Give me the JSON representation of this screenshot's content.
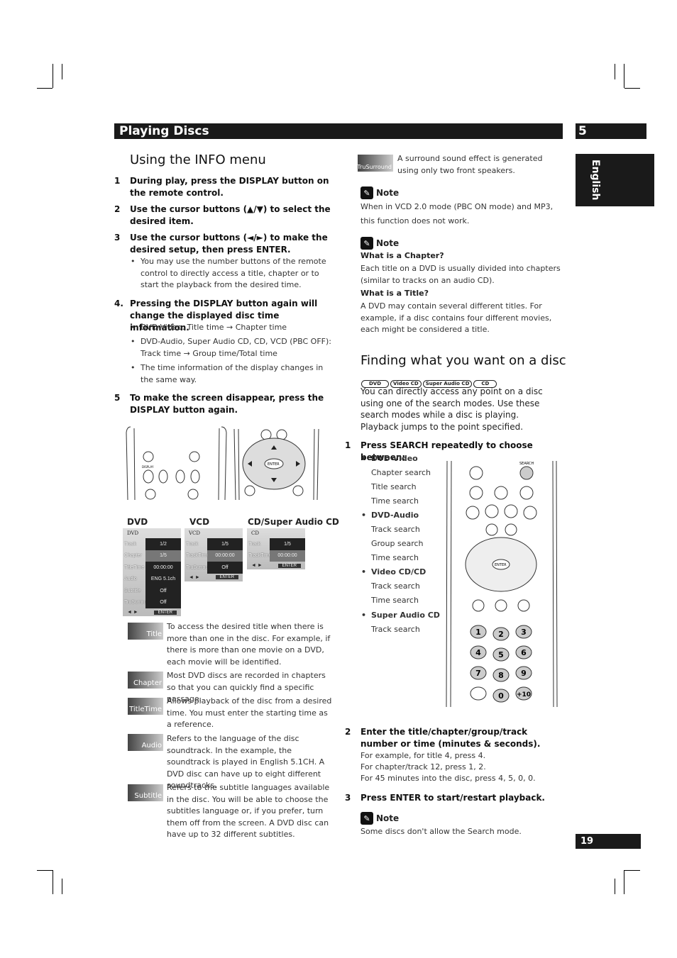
{
  "header": {
    "section_title": "Playing Discs",
    "chapter_number": "5",
    "side_tab": "English",
    "page_number": "19"
  },
  "left": {
    "title": "Using the INFO menu",
    "steps": [
      {
        "n": "1",
        "text": "During play, press the DISPLAY button on the remote control."
      },
      {
        "n": "2",
        "text": "Use the cursor buttons (▲/▼) to select the desired item."
      },
      {
        "n": "3",
        "text": "Use the cursor buttons (◄/►) to make the desired setup, then press ENTER."
      },
      {
        "n": "4.",
        "text": "Pressing the DISPLAY button again will change the displayed disc time information."
      },
      {
        "n": "5",
        "text": "To make the screen disappear, press the DISPLAY button again."
      }
    ],
    "step3_bullet": "You may use the number buttons of the remote control to directly access a title, chapter or to start the playback from the desired time.",
    "step4_bullets": [
      "DVD-Video: Title time → Chapter time",
      "DVD-Audio, Super Audio CD, CD, VCD (PBC OFF): Track time → Group time/Total time",
      "The time information of the display changes in the same way."
    ],
    "remote_labels": {
      "display": "DISPLAY",
      "enter": "ENTER"
    },
    "osd": {
      "dvd": {
        "caption": "DVD",
        "header": "DVD",
        "rows": [
          {
            "label": "Track",
            "value": "1/2"
          },
          {
            "label": "Chapter",
            "value": "1/5"
          },
          {
            "label": "TitleTime",
            "value": "00:00:00"
          },
          {
            "label": "Audio",
            "value": "ENG 5.1ch"
          },
          {
            "label": "Subtitle",
            "value": "Off"
          },
          {
            "label": "TruSurround",
            "value": "Off"
          }
        ],
        "enter": "ENTER"
      },
      "vcd": {
        "caption": "VCD",
        "header": "VCD",
        "rows": [
          {
            "label": "Track",
            "value": "1/5"
          },
          {
            "label": "TrackTime",
            "value": "00:00:00"
          },
          {
            "label": "TruSurround",
            "value": "Off"
          }
        ],
        "enter": "ENTER"
      },
      "cd": {
        "caption": "CD/Super Audio CD",
        "header": "CD",
        "rows": [
          {
            "label": "Track",
            "value": "1/5"
          },
          {
            "label": "TrackTime",
            "value": "00:00:00"
          }
        ],
        "enter": "ENTER"
      }
    },
    "icon_items": [
      {
        "icon": "Title",
        "text": "To access the desired title when there is more than one in the disc. For example, if there is more than one movie on a DVD, each movie will be identified."
      },
      {
        "icon": "Chapter",
        "text": "Most DVD discs are recorded in chapters so that you can quickly find a specific passage."
      },
      {
        "icon": "TitleTime",
        "text": "Allows playback of the disc from a desired time. You must enter the starting time as a reference."
      },
      {
        "icon": "Audio",
        "text": "Refers to the language of the disc soundtrack. In the example, the soundtrack is played in English 5.1CH. A DVD disc can have up to eight different soundtracks."
      },
      {
        "icon": "Subtitle",
        "text": "Refers to the subtitle languages available in the disc. You will be able to choose the subtitles language or, if you prefer, turn them off from the screen. A DVD disc can have up to 32 different subtitles."
      }
    ]
  },
  "right": {
    "surround": {
      "icon": "TruSurround",
      "text": "A surround sound effect is generated using only two front speakers."
    },
    "note1": {
      "label": "Note",
      "text": "When in VCD 2.0 mode (PBC ON mode) and MP3, this function does not work."
    },
    "note2": {
      "label": "Note",
      "q1": "What is a Chapter?",
      "a1": "Each title on a DVD is usually divided into chapters (similar to tracks on an audio CD).",
      "q2": "What is a Title?",
      "a2": "A DVD may contain several different titles. For example, if a disc contains four different movies, each might be considered a title."
    },
    "title": "Finding what you want on a disc",
    "badges": [
      "DVD",
      "Video CD",
      "Super Audio CD",
      "CD"
    ],
    "intro": "You can directly access any point on a disc using one of the search modes. Use these search modes while a disc is playing. Playback jumps to the point specified.",
    "step1": {
      "n": "1",
      "text": "Press SEARCH repeatedly to choose between:"
    },
    "search_groups": [
      {
        "disc": "DVD-Video",
        "modes": [
          "Chapter search",
          "Title search",
          "Time search"
        ]
      },
      {
        "disc": "DVD-Audio",
        "modes": [
          "Track search",
          "Group search",
          "Time search"
        ]
      },
      {
        "disc": "Video CD/CD",
        "modes": [
          "Track search",
          "Time search"
        ]
      },
      {
        "disc": "Super Audio CD",
        "modes": [
          "Track search"
        ]
      }
    ],
    "remote_labels": {
      "search": "SEARCH",
      "enter": "ENTER",
      "numbers": [
        "1",
        "2",
        "3",
        "4",
        "5",
        "6",
        "7",
        "8",
        "9",
        "",
        "0",
        "+10"
      ]
    },
    "step2": {
      "n": "2",
      "text": "Enter the title/chapter/group/track number or time (minutes & seconds).",
      "ex1": "For example, for title 4, press 4.",
      "ex2": "For chapter/track 12, press 1, 2.",
      "ex3": "For 45 minutes into the disc, press 4, 5, 0, 0."
    },
    "step3": {
      "n": "3",
      "text": "Press ENTER to start/restart playback."
    },
    "note3": {
      "label": "Note",
      "text": "Some discs don't allow the Search mode."
    }
  }
}
